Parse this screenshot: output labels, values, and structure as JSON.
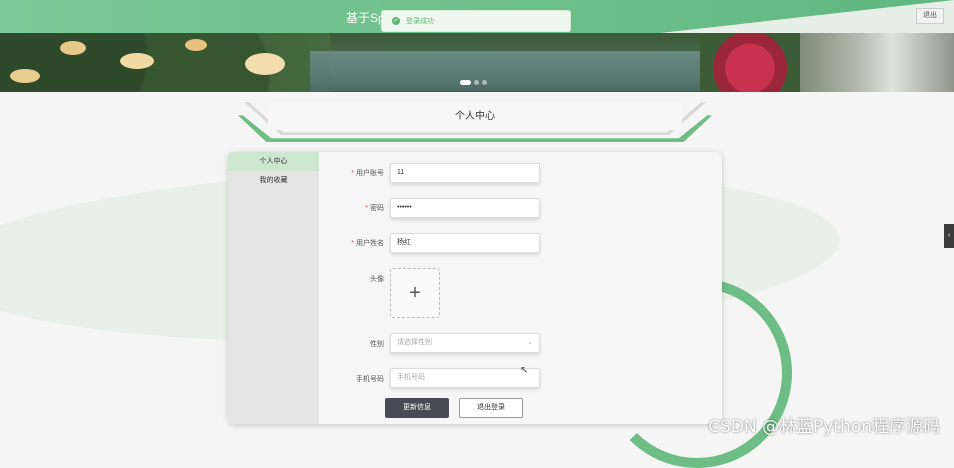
{
  "header": {
    "title": "基于Sp",
    "logout_label": "退出"
  },
  "toast": {
    "message": "登录成功",
    "icon": "check-circle-icon"
  },
  "banner": {
    "slide_count": 3,
    "active_slide": 1
  },
  "page": {
    "heading": "个人中心"
  },
  "sidebar": {
    "items": [
      {
        "label": "个人中心",
        "active": true
      },
      {
        "label": "我的收藏",
        "active": false
      }
    ]
  },
  "form": {
    "account": {
      "label": "用户账号",
      "value": "11",
      "required": true
    },
    "password": {
      "label": "密码",
      "value": "••••••",
      "required": true
    },
    "name": {
      "label": "用户姓名",
      "value": "杨红",
      "required": true
    },
    "avatar": {
      "label": "头像",
      "icon": "plus-icon"
    },
    "gender": {
      "label": "性别",
      "placeholder": "请选择性别"
    },
    "phone": {
      "label": "手机号码",
      "placeholder": "手机号码"
    }
  },
  "buttons": {
    "update": "更新信息",
    "logout": "退出登录"
  },
  "watermark": "CSDN @林蓝Python程序源码",
  "colors": {
    "accent": "#6dbd85",
    "button_dark": "#4a4a56"
  }
}
